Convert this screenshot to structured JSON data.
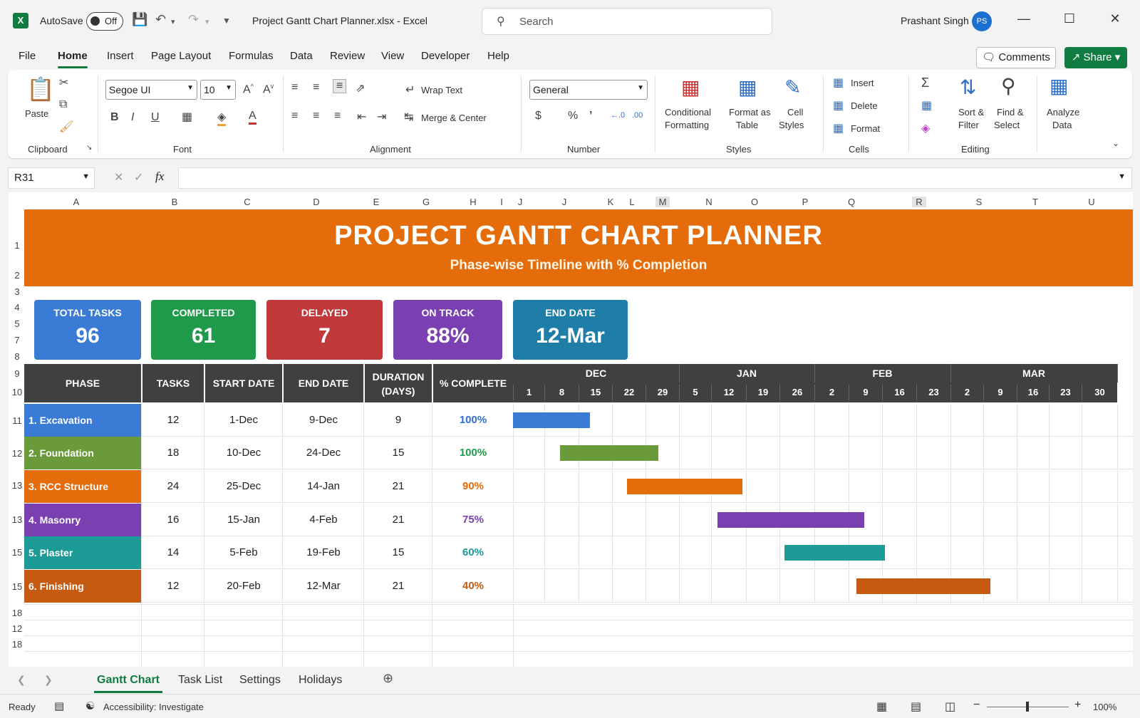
{
  "titlebar": {
    "autosave_label": "AutoSave",
    "autosave_state": "Off",
    "document_title": "Project Gantt Chart Planner.xlsx  -  Excel",
    "search_placeholder": "Search",
    "user_name": "Prashant Singh",
    "user_initials": "PS"
  },
  "menu": {
    "items": [
      "File",
      "Home",
      "Insert",
      "Page Layout",
      "Formulas",
      "Data",
      "Review",
      "View",
      "Developer",
      "Help"
    ],
    "active": "Home",
    "comments_label": "Comments",
    "share_label": "Share"
  },
  "ribbon": {
    "clipboard": {
      "paste": "Paste",
      "group": "Clipboard"
    },
    "font": {
      "family": "Segoe UI",
      "size": "10",
      "group": "Font"
    },
    "alignment": {
      "wrap_text": "Wrap Text",
      "merge_center": "Merge & Center",
      "group": "Alignment"
    },
    "number": {
      "format": "General",
      "group": "Number"
    },
    "styles": {
      "conditional": "Conditional",
      "conditional2": "Formatting",
      "format_as": "Format as",
      "format_as2": "Table",
      "cell": "Cell",
      "cell2": "Styles",
      "group": "Styles"
    },
    "cells": {
      "insert": "Insert",
      "delete": "Delete",
      "format": "Format",
      "group": "Cells"
    },
    "editing": {
      "sort": "Sort &",
      "sort2": "Filter",
      "find": "Find &",
      "find2": "Select",
      "group": "Editing"
    },
    "analyze": {
      "label": "Analyze",
      "label2": "Data"
    }
  },
  "namebox": "R31",
  "columns": [
    "A",
    "B",
    "C",
    "D",
    "E",
    "G",
    "H",
    "I",
    "J",
    "J",
    "K",
    "L",
    "M",
    "N",
    "O",
    "P",
    "Q",
    "R",
    "S",
    "T",
    "U"
  ],
  "rows": [
    "1",
    "2",
    "3",
    "4",
    "5",
    "7",
    "8",
    "9",
    "10",
    "11",
    "12",
    "13",
    "13",
    "15",
    "15",
    "18",
    "12",
    "18"
  ],
  "banner": {
    "title": "PROJECT GANTT CHART PLANNER",
    "subtitle": "Phase-wise Timeline with % Completion"
  },
  "kpis": [
    {
      "label": "TOTAL TASKS",
      "value": "96",
      "color": "#3a7bd5"
    },
    {
      "label": "COMPLETED",
      "value": "61",
      "color": "#1e9a4a"
    },
    {
      "label": "DELAYED",
      "value": "7",
      "color": "#c0393b"
    },
    {
      "label": "ON TRACK",
      "value": "88%",
      "color": "#7a3fb0"
    },
    {
      "label": "END DATE",
      "value": "12-Mar",
      "color": "#1e7ea8"
    }
  ],
  "table": {
    "headers": [
      "PHASE",
      "TASKS",
      "START DATE",
      "END DATE",
      "DURATION",
      "(DAYS)",
      "% COMPLETE"
    ],
    "rows": [
      {
        "phase": "1. Excavation",
        "tasks": "12",
        "start": "1-Dec",
        "end": "9-Dec",
        "duration": "9",
        "complete": "100%",
        "color": "#3a7bd5",
        "pct_color": "#2f6fc4",
        "bar_start": 0,
        "bar_end": 2.3
      },
      {
        "phase": "2. Foundation",
        "tasks": "18",
        "start": "10-Dec",
        "end": "24-Dec",
        "duration": "15",
        "complete": "100%",
        "color": "#6a9a3a",
        "pct_color": "#1e9a4a",
        "bar_start": 1.4,
        "bar_end": 4.35
      },
      {
        "phase": "3. RCC Structure",
        "tasks": "24",
        "start": "25-Dec",
        "end": "14-Jan",
        "duration": "21",
        "complete": "90%",
        "color": "#e46c0a",
        "pct_color": "#e46c0a",
        "bar_start": 3.4,
        "bar_end": 6.85
      },
      {
        "phase": "4. Masonry",
        "tasks": "16",
        "start": "15-Jan",
        "end": "4-Feb",
        "duration": "21",
        "complete": "75%",
        "color": "#7a3fb0",
        "pct_color": "#7a3fb0",
        "bar_start": 6.1,
        "bar_end": 10.5
      },
      {
        "phase": "5. Plaster",
        "tasks": "14",
        "start": "5-Feb",
        "end": "19-Feb",
        "duration": "15",
        "complete": "60%",
        "color": "#1b9a96",
        "pct_color": "#1b9a96",
        "bar_start": 8.1,
        "bar_end": 11.1
      },
      {
        "phase": "6. Finishing",
        "tasks": "12",
        "start": "20-Feb",
        "end": "12-Mar",
        "duration": "21",
        "complete": "40%",
        "color": "#c55a11",
        "pct_color": "#c55a11",
        "bar_start": 10.25,
        "bar_end": 14.25
      }
    ]
  },
  "timeline": {
    "months": [
      {
        "name": "DEC",
        "span": 5
      },
      {
        "name": "JAN",
        "span": 4
      },
      {
        "name": "FEB",
        "span": 4
      },
      {
        "name": "MAR",
        "span": 5
      }
    ],
    "days": [
      "1",
      "8",
      "15",
      "22",
      "29",
      "5",
      "12",
      "19",
      "26",
      "2",
      "9",
      "16",
      "23",
      "2",
      "9",
      "16",
      "23",
      "30"
    ]
  },
  "sheet_tabs": [
    "Gantt Chart",
    "Task List",
    "Settings",
    "Holidays"
  ],
  "active_tab": "Gantt Chart",
  "status": {
    "ready": "Ready",
    "accessibility": "Accessibility: Investigate",
    "zoom": "100%"
  }
}
